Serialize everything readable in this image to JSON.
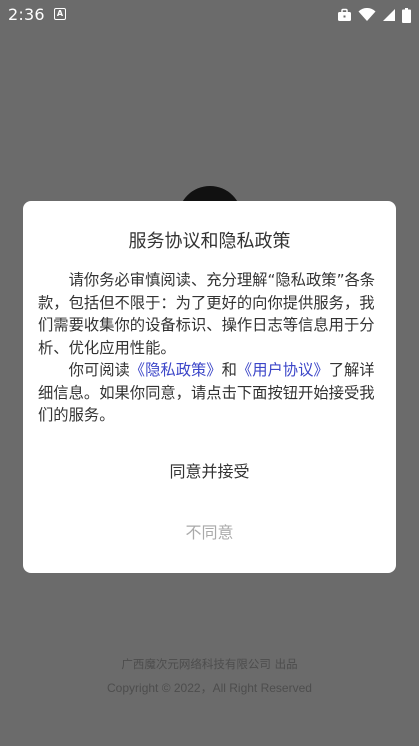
{
  "status_bar": {
    "time": "2:36",
    "notification_icon_letter": "A",
    "icons": [
      "a-notification-icon",
      "briefcase-icon",
      "wifi-icon",
      "signal-icon",
      "battery-icon"
    ]
  },
  "background": {
    "footer_company": "广西魔次元网络科技有限公司 出品",
    "footer_copyright": "Copyright © 2022，All Right Reserved"
  },
  "dialog": {
    "title": "服务协议和隐私政策",
    "para1": "请你务必审慎阅读、充分理解“隐私政策”各条款，包括但不限于：为了更好的向你提供服务，我们需要收集你的设备标识、操作日志等信息用于分析、优化应用性能。",
    "para2_prefix": "你可阅读",
    "privacy_link": "《隐私政策》",
    "para2_and": "和",
    "user_link": "《用户协议》",
    "para2_suffix": "了解详细信息。如果你同意，请点击下面按钮开始接受我们的服务。",
    "agree_label": "同意并接受",
    "disagree_label": "不同意"
  },
  "colors": {
    "overlay": "#6b6b6b",
    "link": "#3c46c8",
    "text": "#333333",
    "disabled_text": "#aaaaaa"
  }
}
